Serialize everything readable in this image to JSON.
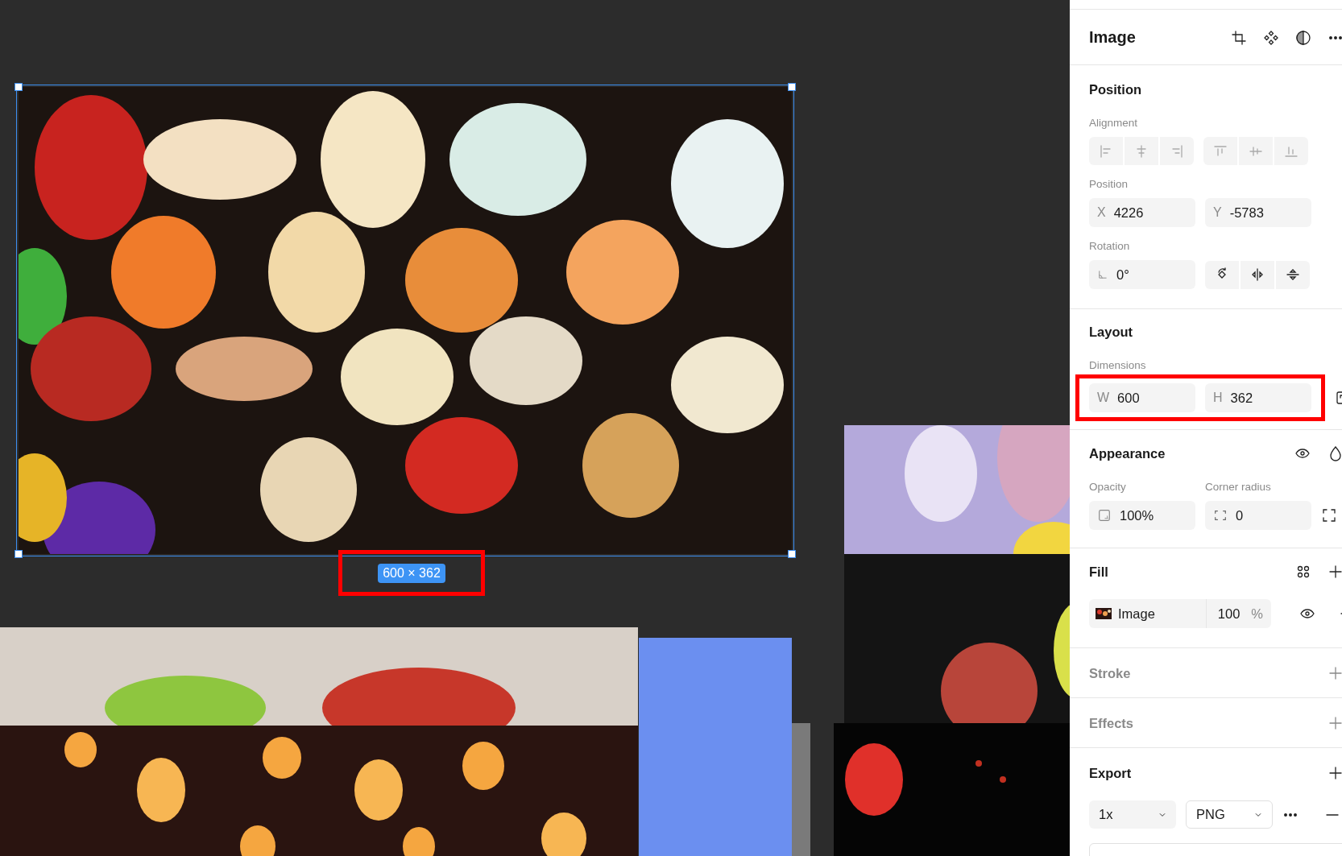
{
  "canvas": {
    "size_label": "600 × 362",
    "size_highlighted": true
  },
  "header": {
    "title": "Image"
  },
  "position": {
    "title": "Position",
    "alignment_label": "Alignment",
    "position_label": "Position",
    "x": {
      "label": "X",
      "value": "4226"
    },
    "y": {
      "label": "Y",
      "value": "-5783"
    },
    "rotation_label": "Rotation",
    "rotation": "0°"
  },
  "layout": {
    "title": "Layout",
    "dimensions_label": "Dimensions",
    "highlighted": true,
    "w": {
      "label": "W",
      "value": "600"
    },
    "h": {
      "label": "H",
      "value": "362"
    }
  },
  "appearance": {
    "title": "Appearance",
    "opacity_label": "Opacity",
    "opacity": "100%",
    "radius_label": "Corner radius",
    "radius": "0"
  },
  "fill": {
    "title": "Fill",
    "name": "Image",
    "amount": "100",
    "unit": "%"
  },
  "sections": [
    {
      "title": "Stroke"
    },
    {
      "title": "Effects"
    }
  ],
  "export": {
    "title": "Export",
    "scale": "1x",
    "format": "PNG"
  }
}
